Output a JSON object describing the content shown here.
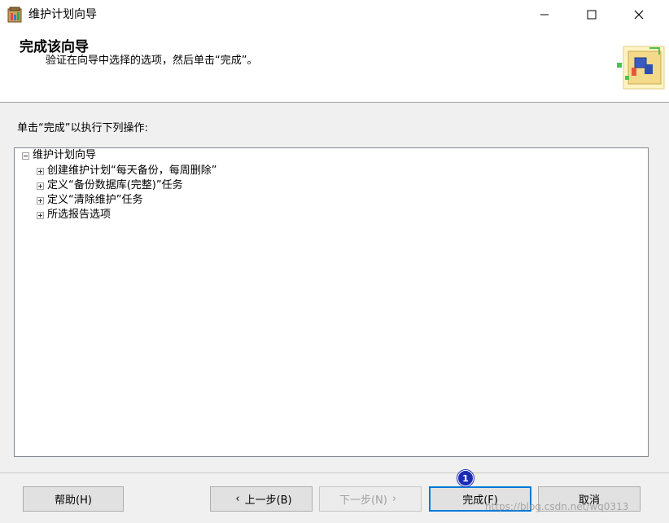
{
  "window": {
    "title": "维护计划向导",
    "icon": "wizard-app-icon",
    "controls": [
      "minimize-icon",
      "maximize-icon",
      "close-icon"
    ]
  },
  "header": {
    "title": "完成该向导",
    "subtitle": "验证在向导中选择的选项，然后单击“完成”。",
    "art": "wizard-graphic-icon"
  },
  "instruction": "单击“完成”以执行下列操作:",
  "tree": {
    "root": "维护计划向导",
    "children": [
      "创建维护计划“每天备份，每周删除”",
      "定义“备份数据库(完整)”任务",
      "定义“清除维护”任务",
      "所选报告选项"
    ]
  },
  "buttons": {
    "help": "帮助(H)",
    "back": "上一步(B)",
    "next": "下一步(N)",
    "finish": "完成(F)",
    "cancel": "取消"
  },
  "badge": "1",
  "watermark": "https://blog.csdn.net/wq0313",
  "colors": {
    "window_bg": "#f0f0f0",
    "focus_border": "#0078d7",
    "badge": "#1c2bb5"
  }
}
